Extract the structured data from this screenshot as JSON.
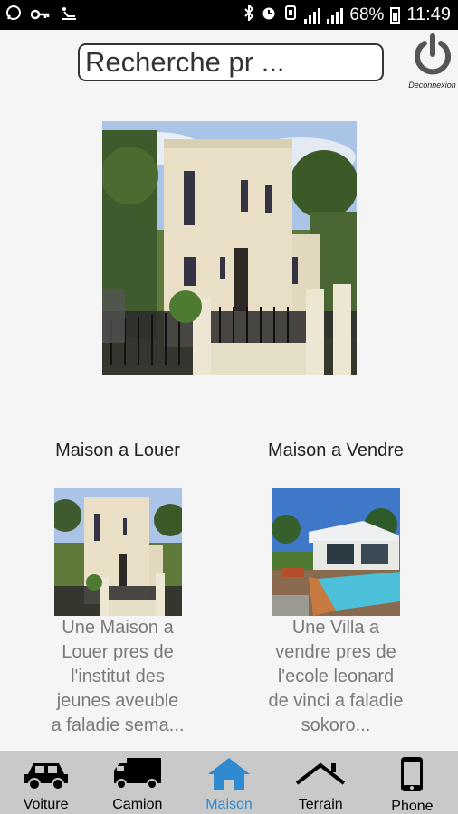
{
  "status_bar": {
    "battery": "68%",
    "time": "11:49"
  },
  "header": {
    "search_placeholder": "Recherche pr ...",
    "logout_label": "Deconnexion"
  },
  "listings": [
    {
      "title": "Maison a Louer",
      "description": "Une Maison a Louer pres de l'institut des jeunes aveuble a faladie sema..."
    },
    {
      "title": "Maison a Vendre",
      "description": "Une Villa a vendre pres de l'ecole leonard de vinci a faladie sokoro..."
    }
  ],
  "bottom_nav": {
    "active": "Maison",
    "items": [
      {
        "label": "Voiture",
        "icon": "car-icon"
      },
      {
        "label": "Camion",
        "icon": "truck-icon"
      },
      {
        "label": "Maison",
        "icon": "home-icon"
      },
      {
        "label": "Terrain",
        "icon": "land-icon"
      },
      {
        "label": "Phone",
        "icon": "phone-icon"
      }
    ]
  },
  "colors": {
    "active_tab": "#2f8ad0",
    "nav_background": "#c9c9c9",
    "status_bar": "#000000"
  }
}
